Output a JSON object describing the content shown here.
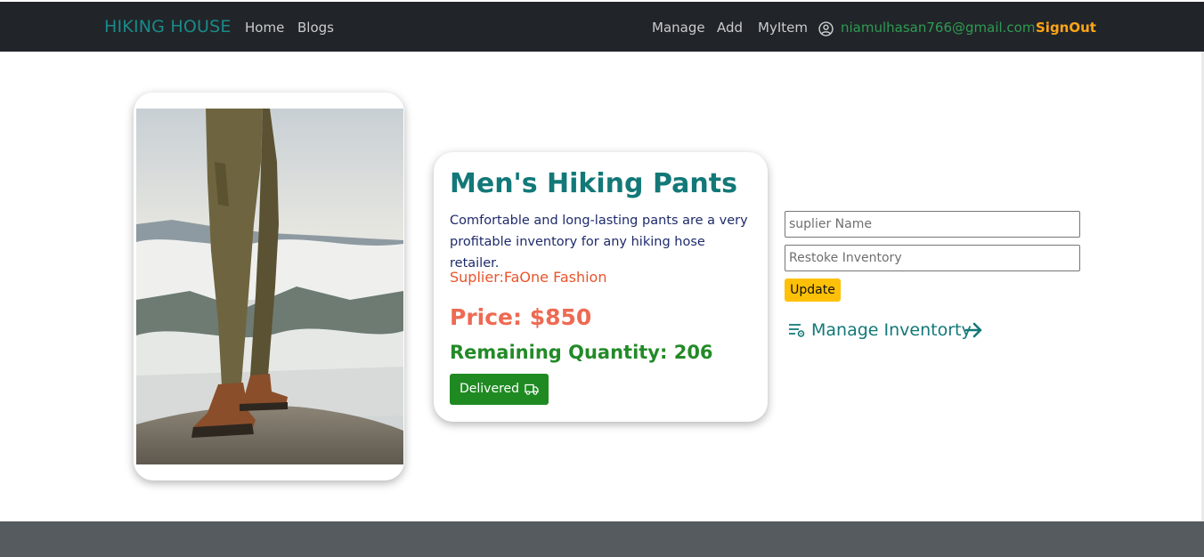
{
  "navbar": {
    "brand": "HIKING HOUSE",
    "links_left": [
      "Home",
      "Blogs"
    ],
    "links_right": [
      "Manage",
      "Add",
      "MyItem"
    ],
    "user_icon": "user-circle-icon",
    "user_email": "niamulhasan766@gmail.com",
    "signout_label": "SignOut"
  },
  "product": {
    "image_alt": "hiking-pants-photo",
    "title": "Men's Hiking Pants",
    "description": "Comfortable and long-lasting pants are a very profitable inventory for any hiking hose retailer.",
    "supplier": "Suplier:FaOne Fashion",
    "price": "Price: $850",
    "quantity": "Remaining Quantity: 206",
    "delivered_label": "Delivered",
    "delivered_icon": "truck-icon"
  },
  "form": {
    "supplier_placeholder": "suplier Name",
    "restock_placeholder": "Restoke Inventory",
    "update_label": "Update"
  },
  "manage_link": {
    "label": "Manage Inventorty",
    "icon": "list-settings-icon",
    "arrow_icon": "arrow-right-icon"
  },
  "colors": {
    "navbar_bg": "#212529",
    "brand": "#1a8a8a",
    "title": "#137878",
    "price": "#ee6a52",
    "quantity": "#238a28",
    "delivered_bg": "#1f8a22",
    "update_bg": "#ffc107",
    "signout": "#ffa516",
    "footer_bg": "#555b5e"
  }
}
